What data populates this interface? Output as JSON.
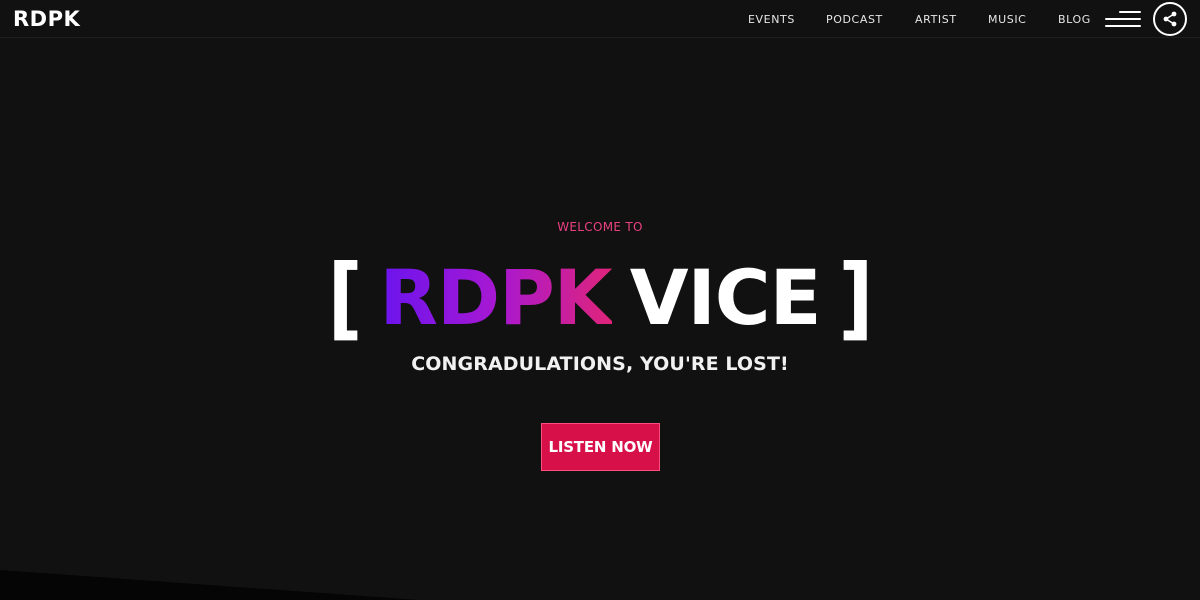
{
  "header": {
    "logo": "RDPK",
    "nav": [
      {
        "label": "EVENTS"
      },
      {
        "label": "PODCAST"
      },
      {
        "label": "ARTIST"
      },
      {
        "label": "MUSIC"
      },
      {
        "label": "BLOG"
      }
    ],
    "menu_icon": "hamburger-menu-icon",
    "share_icon": "share-icon"
  },
  "hero": {
    "eyebrow": "WELCOME TO",
    "bracket_open": "[",
    "brand": "RDPK",
    "title_rest": "VICE",
    "bracket_close": "]",
    "subtitle": "CONGRADULATIONS, YOU'RE LOST!",
    "cta_label": "LISTEN NOW"
  },
  "colors": {
    "background": "#111112",
    "accent_pink": "#e8417f",
    "cta_red": "#d8104a",
    "gradient_start": "#6a14ee",
    "gradient_end": "#e0247a"
  }
}
